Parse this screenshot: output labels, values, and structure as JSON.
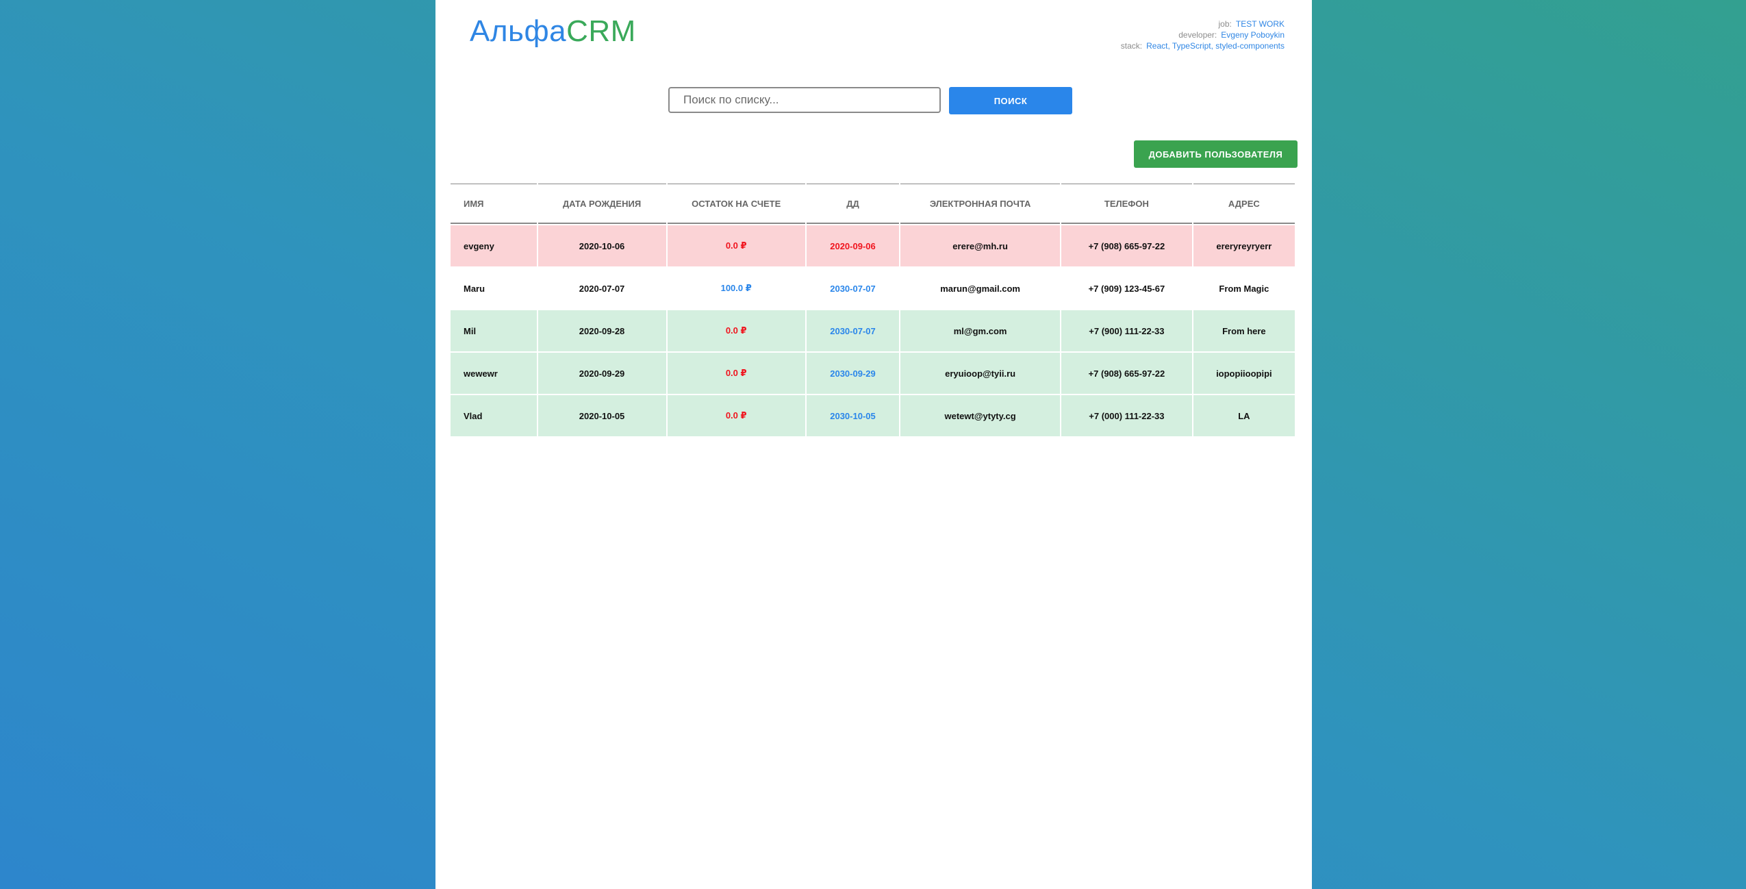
{
  "header": {
    "logo_main": "Альфа",
    "logo_accent": "CRM",
    "meta": [
      {
        "key": "job:",
        "value": "TEST WORK"
      },
      {
        "key": "developer:",
        "value": "Evgeny Poboykin"
      },
      {
        "key": "stack:",
        "value": "React, TypeScript, styled-components"
      }
    ]
  },
  "search": {
    "placeholder": "Поиск по списку...",
    "button_label": "ПОИСК"
  },
  "toolbar": {
    "add_user_label": "ДОБАВИТЬ ПОЛЬЗОВАТЕЛЯ"
  },
  "colors": {
    "accent_blue": "#2a86ea",
    "accent_green": "#3aa34f",
    "debt_row": "#fbd3d6",
    "ok_row": "#d4efdf",
    "negative_text": "#f0141e"
  },
  "table": {
    "columns": [
      "ИМЯ",
      "ДАТА РОЖДЕНИЯ",
      "ОСТАТОК НА СЧЕТЕ",
      "ДД",
      "ЭЛЕКТРОННАЯ ПОЧТА",
      "ТЕЛЕФОН",
      "АДРЕС"
    ],
    "rows": [
      {
        "name": "evgeny",
        "birthdate": "2020-10-06",
        "balance": "0.0 ₽",
        "dd": "2020-09-06",
        "email": "erere@mh.ru",
        "phone": "+7 (908) 665-97-22",
        "address": "ereryreyryerr",
        "row_status": "debt",
        "balance_status": "neg",
        "dd_status": "neg"
      },
      {
        "name": "Maru",
        "birthdate": "2020-07-07",
        "balance": "100.0 ₽",
        "dd": "2030-07-07",
        "email": "marun@gmail.com",
        "phone": "+7 (909) 123-45-67",
        "address": "From Magic",
        "row_status": "plain",
        "balance_status": "pos",
        "dd_status": "pos"
      },
      {
        "name": "Mil",
        "birthdate": "2020-09-28",
        "balance": "0.0 ₽",
        "dd": "2030-07-07",
        "email": "ml@gm.com",
        "phone": "+7 (900) 111-22-33",
        "address": "From here",
        "row_status": "ok",
        "balance_status": "neg",
        "dd_status": "pos"
      },
      {
        "name": "wewewr",
        "birthdate": "2020-09-29",
        "balance": "0.0 ₽",
        "dd": "2030-09-29",
        "email": "eryuioop@tyii.ru",
        "phone": "+7 (908) 665-97-22",
        "address": "iopopiioopipi",
        "row_status": "ok",
        "balance_status": "neg",
        "dd_status": "pos"
      },
      {
        "name": "Vlad",
        "birthdate": "2020-10-05",
        "balance": "0.0 ₽",
        "dd": "2030-10-05",
        "email": "wetewt@ytyty.cg",
        "phone": "+7 (000) 111-22-33",
        "address": "LA",
        "row_status": "ok",
        "balance_status": "neg",
        "dd_status": "pos"
      }
    ]
  }
}
